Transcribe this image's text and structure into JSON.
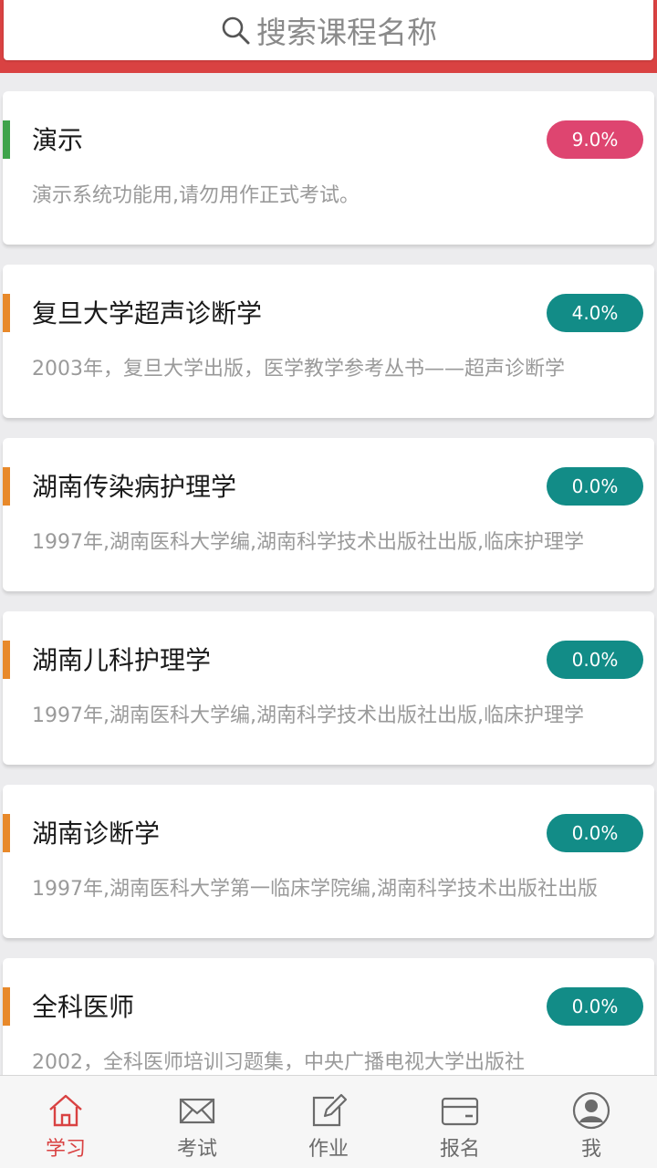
{
  "search": {
    "placeholder": "搜索课程名称",
    "icon": "search-icon"
  },
  "colors": {
    "accent": "#d94242",
    "badge_red": "#de4570",
    "badge_teal": "#128c87",
    "stripe_green": "#3ea34a",
    "stripe_orange": "#e8892a"
  },
  "courses": [
    {
      "title": "演示",
      "desc": "演示系统功能用,请勿用作正式考试。",
      "progress": "9.0%",
      "badge_color": "#de4570",
      "stripe_color": "#3ea34a"
    },
    {
      "title": "复旦大学超声诊断学",
      "desc": "2003年，复旦大学出版，医学教学参考丛书——超声诊断学",
      "progress": "4.0%",
      "badge_color": "#128c87",
      "stripe_color": "#e8892a"
    },
    {
      "title": "湖南传染病护理学",
      "desc": "1997年,湖南医科大学编,湖南科学技术出版社出版,临床护理学",
      "progress": "0.0%",
      "badge_color": "#128c87",
      "stripe_color": "#e8892a"
    },
    {
      "title": "湖南儿科护理学",
      "desc": "1997年,湖南医科大学编,湖南科学技术出版社出版,临床护理学",
      "progress": "0.0%",
      "badge_color": "#128c87",
      "stripe_color": "#e8892a"
    },
    {
      "title": "湖南诊断学",
      "desc": "1997年,湖南医科大学第一临床学院编,湖南科学技术出版社出版",
      "progress": "0.0%",
      "badge_color": "#128c87",
      "stripe_color": "#e8892a"
    },
    {
      "title": "全科医师",
      "desc": "2002，全科医师培训习题集，中央广播电视大学出版社",
      "progress": "0.0%",
      "badge_color": "#128c87",
      "stripe_color": "#e8892a"
    }
  ],
  "nav": {
    "items": [
      {
        "label": "学习",
        "icon": "home-icon",
        "active": true
      },
      {
        "label": "考试",
        "icon": "mail-icon",
        "active": false
      },
      {
        "label": "作业",
        "icon": "edit-icon",
        "active": false
      },
      {
        "label": "报名",
        "icon": "card-icon",
        "active": false
      },
      {
        "label": "我",
        "icon": "user-icon",
        "active": false
      }
    ]
  }
}
